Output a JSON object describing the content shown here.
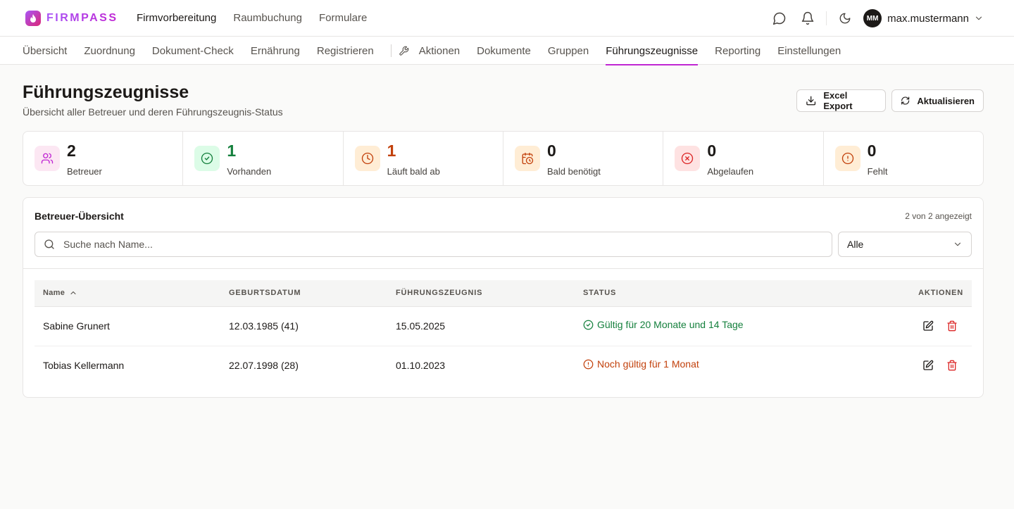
{
  "app": {
    "logo_text": "FIRMPASS"
  },
  "topnav": [
    {
      "label": "Firmvorbereitung",
      "active": true
    },
    {
      "label": "Raumbuchung",
      "active": false
    },
    {
      "label": "Formulare",
      "active": false
    }
  ],
  "user": {
    "initials": "MM",
    "name": "max.mustermann"
  },
  "subnav": [
    {
      "label": "Übersicht"
    },
    {
      "label": "Zuordnung"
    },
    {
      "label": "Dokument-Check"
    },
    {
      "label": "Ernährung"
    },
    {
      "label": "Registrieren"
    },
    {
      "label": "Aktionen"
    },
    {
      "label": "Dokumente"
    },
    {
      "label": "Gruppen"
    },
    {
      "label": "Führungszeugnisse",
      "active": true
    },
    {
      "label": "Reporting"
    },
    {
      "label": "Einstellungen"
    }
  ],
  "page": {
    "title": "Führungszeugnisse",
    "subtitle": "Übersicht aller Betreuer und deren Führungszeugnis-Status",
    "export_label": "Excel Export",
    "refresh_label": "Aktualisieren"
  },
  "stats": [
    {
      "value": "2",
      "label": "Betreuer",
      "color": "#1c1917",
      "icon_bg": "#fce7f3",
      "icon_color": "#c026d3",
      "icon": "users-icon"
    },
    {
      "value": "1",
      "label": "Vorhanden",
      "color": "#15803d",
      "icon_bg": "#dcfce7",
      "icon_color": "#15803d",
      "icon": "check-circle-icon"
    },
    {
      "value": "1",
      "label": "Läuft bald ab",
      "color": "#c2410c",
      "icon_bg": "#ffedd5",
      "icon_color": "#c2410c",
      "icon": "clock-icon"
    },
    {
      "value": "0",
      "label": "Bald benötigt",
      "color": "#1c1917",
      "icon_bg": "#ffedd5",
      "icon_color": "#c2410c",
      "icon": "calendar-clock-icon"
    },
    {
      "value": "0",
      "label": "Abgelaufen",
      "color": "#1c1917",
      "icon_bg": "#fee2e2",
      "icon_color": "#dc2626",
      "icon": "x-circle-icon"
    },
    {
      "value": "0",
      "label": "Fehlt",
      "color": "#1c1917",
      "icon_bg": "#ffedd5",
      "icon_color": "#c2410c",
      "icon": "alert-circle-icon"
    }
  ],
  "table_card": {
    "title": "Betreuer-Übersicht",
    "count_text": "2 von 2 angezeigt",
    "search_placeholder": "Suche nach Name...",
    "filter_value": "Alle",
    "columns": [
      "Name",
      "GEBURTSDATUM",
      "FÜHRUNGSZEUGNIS",
      "STATUS",
      "AKTIONEN"
    ],
    "rows": [
      {
        "name": "Sabine Grunert",
        "birthdate": "12.03.1985 (41)",
        "certificate_date": "15.05.2025",
        "status": "Gültig für 20 Monate und 14 Tage",
        "status_type": "ok"
      },
      {
        "name": "Tobias Kellermann",
        "birthdate": "22.07.1998 (28)",
        "certificate_date": "01.10.2023",
        "status": "Noch gültig für 1 Monat",
        "status_type": "warn"
      }
    ]
  }
}
